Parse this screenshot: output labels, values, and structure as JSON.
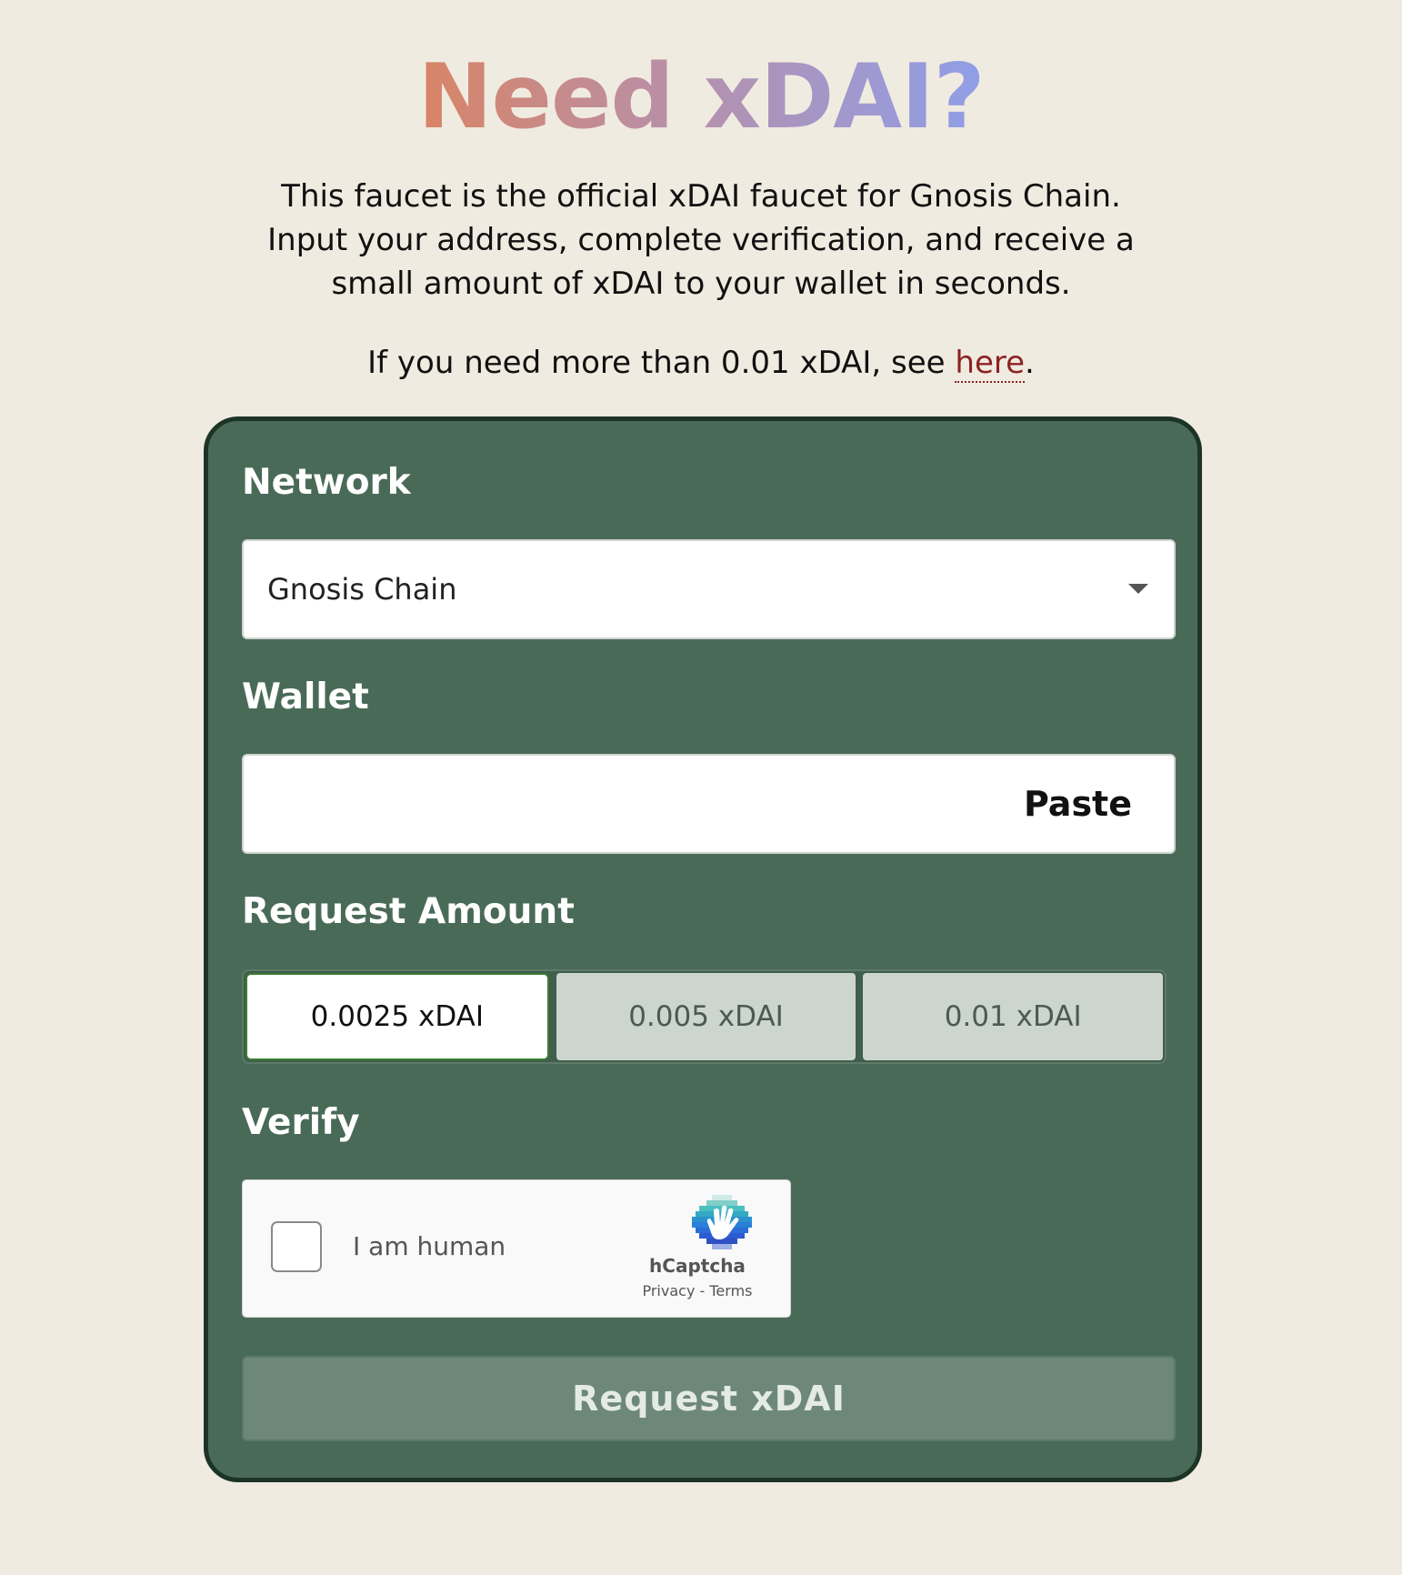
{
  "hero": {
    "title": "Need xDAI?",
    "intro_line1": "This faucet is the official xDAI faucet for Gnosis Chain.",
    "intro_line2": "Input your address, complete verification, and receive a",
    "intro_line3": "small amount of xDAI to your wallet in seconds.",
    "more_prefix": "If you need more than 0.01 xDAI, see ",
    "more_link": "here",
    "more_suffix": "."
  },
  "form": {
    "network_label": "Network",
    "network_value": "Gnosis Chain",
    "wallet_label": "Wallet",
    "wallet_value": "",
    "paste_label": "Paste",
    "amount_label": "Request Amount",
    "amounts": [
      "0.0025 xDAI",
      "0.005 xDAI",
      "0.01 xDAI"
    ],
    "selected_amount": "0.0025 xDAI",
    "verify_label": "Verify",
    "submit_label": "Request xDAI"
  },
  "captcha": {
    "text": "I am human",
    "brand": "hCaptcha",
    "privacy": "Privacy",
    "separator": " - ",
    "terms": "Terms",
    "icon": "hcaptcha-hand-icon"
  },
  "colors": {
    "background": "#f0ebe0",
    "card": "#4a6a58",
    "card_border": "#1c3426",
    "link": "#8c2323",
    "title_gradient_start": "#d98466",
    "title_gradient_end": "#8f9ee8"
  }
}
